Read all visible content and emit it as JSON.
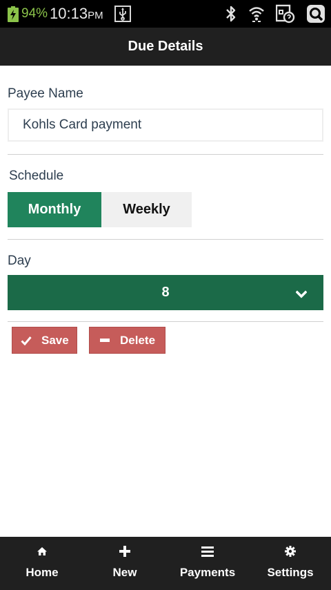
{
  "status_bar": {
    "battery_percent": "94%",
    "time": "10:13",
    "time_suffix": "PM",
    "battery_color": "#8bc34a",
    "icons": [
      "battery-charging-icon",
      "usb-icon",
      "bluetooth-icon",
      "wifi-icon",
      "screenshot-app-icon",
      "search-app-icon"
    ]
  },
  "header": {
    "title": "Due Details"
  },
  "payee": {
    "label": "Payee Name",
    "value": "Kohls Card payment"
  },
  "schedule": {
    "label": "Schedule",
    "options": [
      "Monthly",
      "Weekly"
    ],
    "selected": "Monthly",
    "active_color": "#20845c"
  },
  "day": {
    "label": "Day",
    "value": "8",
    "color": "#1b6a48"
  },
  "actions": {
    "save_label": "Save",
    "delete_label": "Delete",
    "color": "#c65c5a"
  },
  "nav": {
    "items": [
      {
        "label": "Home",
        "icon": "home-icon"
      },
      {
        "label": "New",
        "icon": "plus-icon"
      },
      {
        "label": "Payments",
        "icon": "list-icon"
      },
      {
        "label": "Settings",
        "icon": "gear-icon"
      }
    ]
  }
}
